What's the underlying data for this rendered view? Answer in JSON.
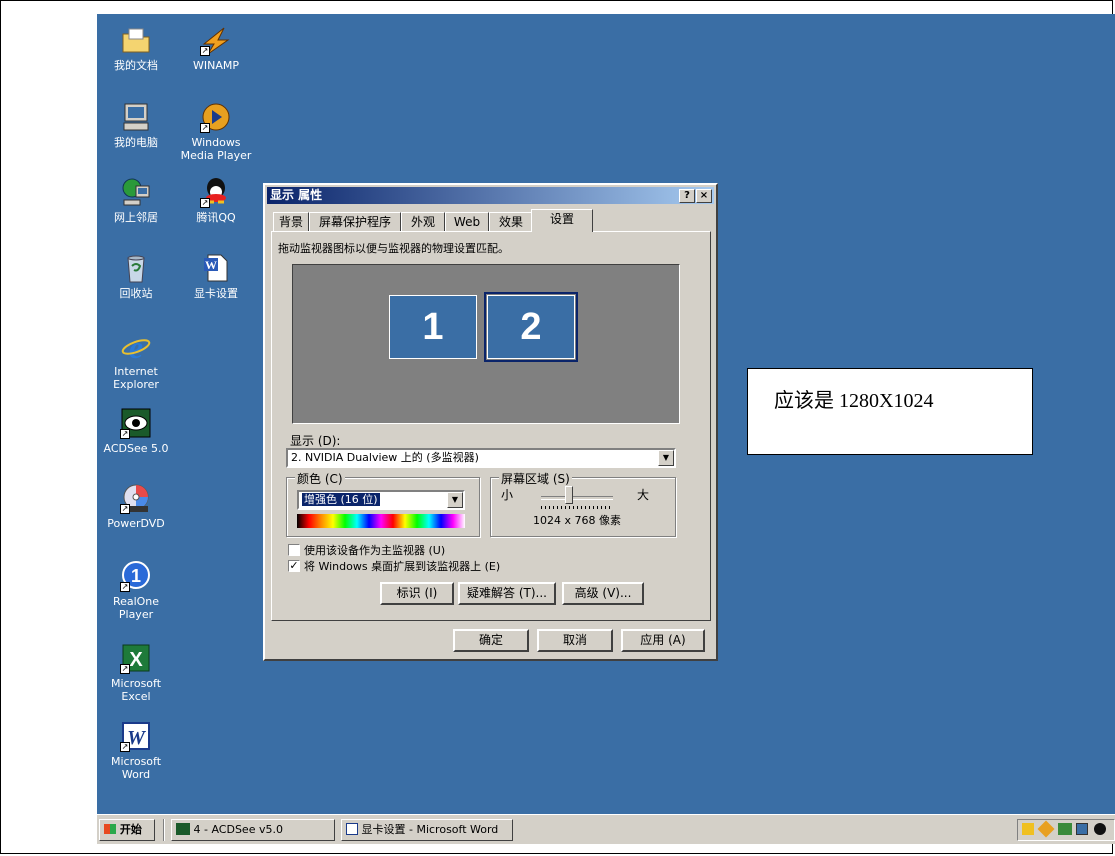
{
  "desktop": {
    "icons": [
      {
        "id": "my-documents",
        "label": "我的文档",
        "icon": "folder-icon"
      },
      {
        "id": "winamp",
        "label": "WINAMP",
        "icon": "winamp-icon"
      },
      {
        "id": "my-computer",
        "label": "我的电脑",
        "icon": "computer-icon"
      },
      {
        "id": "wmp",
        "label": "Windows Media Player",
        "icon": "media-player-icon"
      },
      {
        "id": "network",
        "label": "网上邻居",
        "icon": "network-icon"
      },
      {
        "id": "qq",
        "label": "腾讯QQ",
        "icon": "qq-icon"
      },
      {
        "id": "recycle-bin",
        "label": "回收站",
        "icon": "recycle-bin-icon"
      },
      {
        "id": "doc",
        "label": "显卡设置",
        "icon": "word-document-icon"
      },
      {
        "id": "ie",
        "label": "Internet Explorer",
        "icon": "internet-explorer-icon"
      },
      {
        "id": "acdsee",
        "label": "ACDSee 5.0",
        "icon": "acdsee-icon"
      },
      {
        "id": "powerdvd",
        "label": "PowerDVD",
        "icon": "powerdvd-icon"
      },
      {
        "id": "realone",
        "label": "RealOne Player",
        "icon": "realone-icon"
      },
      {
        "id": "excel",
        "label": "Microsoft Excel",
        "icon": "excel-icon"
      },
      {
        "id": "word",
        "label": "Microsoft Word",
        "icon": "word-icon"
      }
    ]
  },
  "dialog": {
    "title": "显示 属性",
    "help_btn": "?",
    "close_btn": "×",
    "tabs": [
      "背景",
      "屏幕保护程序",
      "外观",
      "Web",
      "效果",
      "设置"
    ],
    "active_tab": "设置",
    "instruction": "拖动监视器图标以便与监视器的物理设置匹配。",
    "monitors": [
      "1",
      "2"
    ],
    "display_label": "显示 (D):",
    "display_value": "2. NVIDIA Dualview 上的 (多监视器)",
    "color_group": "颜色 (C)",
    "color_value": "增强色 (16 位)",
    "area_group": "屏幕区域 (S)",
    "area_small": "小",
    "area_large": "大",
    "area_value": "1024 x 768 像素",
    "checkbox_primary": "使用该设备作为主监视器 (U)",
    "checkbox_primary_checked": false,
    "checkbox_extend": "将 Windows 桌面扩展到该监视器上 (E)",
    "checkbox_extend_checked": true,
    "btn_identify": "标识 (I)",
    "btn_troubleshoot": "疑难解答 (T)...",
    "btn_advanced": "高级 (V)...",
    "btn_ok": "确定",
    "btn_cancel": "取消",
    "btn_apply": "应用 (A)"
  },
  "callout": "应该是 1280X1024",
  "taskbar": {
    "start": "开始",
    "tasks": [
      "4 - ACDSee v5.0",
      "显卡设置 - Microsoft Word"
    ]
  },
  "colors": {
    "desktop": "#3a6ea5",
    "titlebar": "#0a246a",
    "face": "#d4d0c8"
  }
}
